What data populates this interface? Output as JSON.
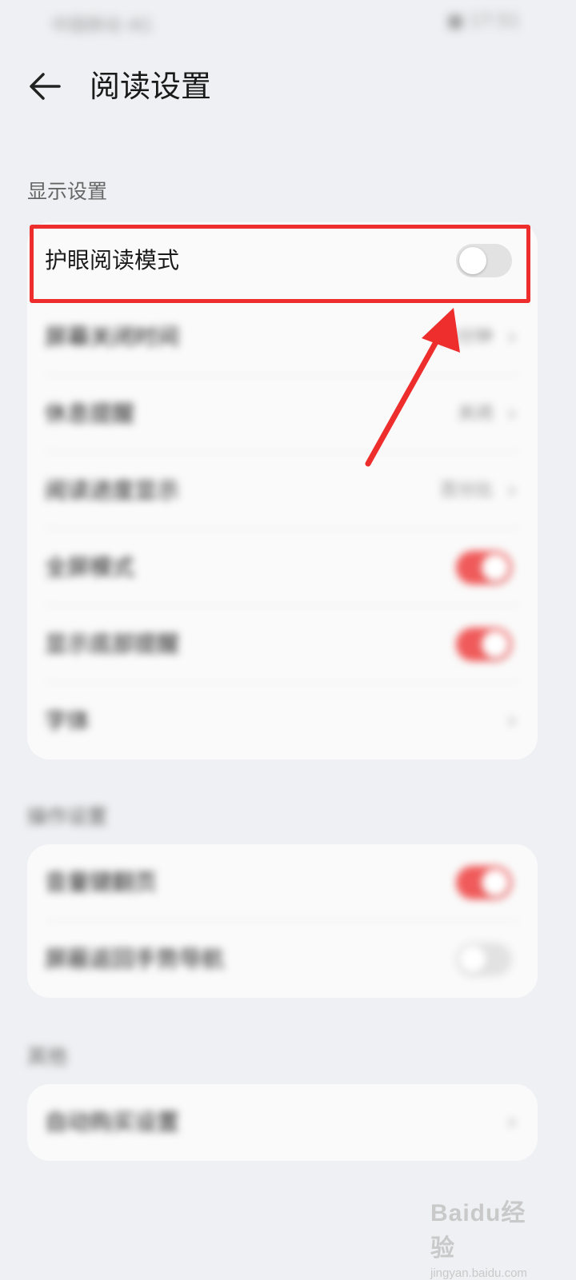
{
  "status_bar": {
    "left_text": "中国移动 4G",
    "right_text": "■ 17:51"
  },
  "header": {
    "title": "阅读设置"
  },
  "display_section": {
    "title": "显示设置",
    "items": [
      {
        "label": "护眼阅读模式",
        "type": "toggle",
        "state": false
      },
      {
        "label": "屏幕关闭时间",
        "type": "value",
        "value": "15分钟"
      },
      {
        "label": "休息提醒",
        "type": "value",
        "value": "关闭"
      },
      {
        "label": "阅读进度显示",
        "type": "value",
        "value": "百分比"
      },
      {
        "label": "全屏模式",
        "type": "toggle",
        "state": true
      },
      {
        "label": "显示底部提醒",
        "type": "toggle",
        "state": true
      },
      {
        "label": "字体",
        "type": "chevron"
      }
    ]
  },
  "operation_section": {
    "title": "操作设置",
    "items": [
      {
        "label": "音量键翻页",
        "type": "toggle",
        "state": true
      },
      {
        "label": "屏蔽返回手势导航",
        "type": "toggle",
        "state": false
      }
    ]
  },
  "other_section": {
    "title": "其他",
    "items": [
      {
        "label": "自动购买设置",
        "type": "chevron"
      }
    ]
  },
  "watermark": {
    "logo": "Baidu经验",
    "sub": "jingyan.baidu.com"
  },
  "colors": {
    "accent": "#f05a5a",
    "highlight": "#ee2d2d",
    "background": "#eef0f3"
  },
  "icons": {
    "back": "arrow-left-icon",
    "chevron": "chevron-right-icon"
  }
}
